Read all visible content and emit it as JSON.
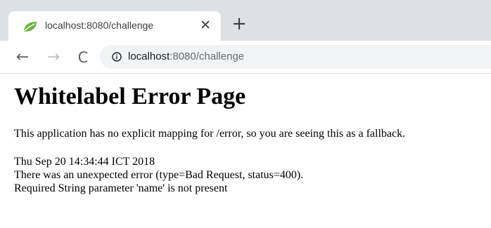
{
  "tab": {
    "title": "localhost:8080/challenge",
    "close_glyph": "✕",
    "favicon": "spring-leaf-icon"
  },
  "new_tab_glyph": "+",
  "nav": {
    "back_glyph": "←",
    "forward_glyph": "→",
    "reload_glyph": "C"
  },
  "address_bar": {
    "host": "localhost",
    "rest": ":8080/challenge"
  },
  "page": {
    "heading": "Whitelabel Error Page",
    "message": "This application has no explicit mapping for /error, so you are seeing this as a fallback.",
    "timestamp": "Thu Sep 20 14:34:44 ICT 2018",
    "error_line": "There was an unexpected error (type=Bad Request, status=400).",
    "detail_line": "Required String parameter 'name' is not present"
  },
  "colors": {
    "tabstrip_bg": "#dee1e6",
    "omnibox_bg": "#f1f3f4",
    "spring_green": "#6db33f"
  }
}
